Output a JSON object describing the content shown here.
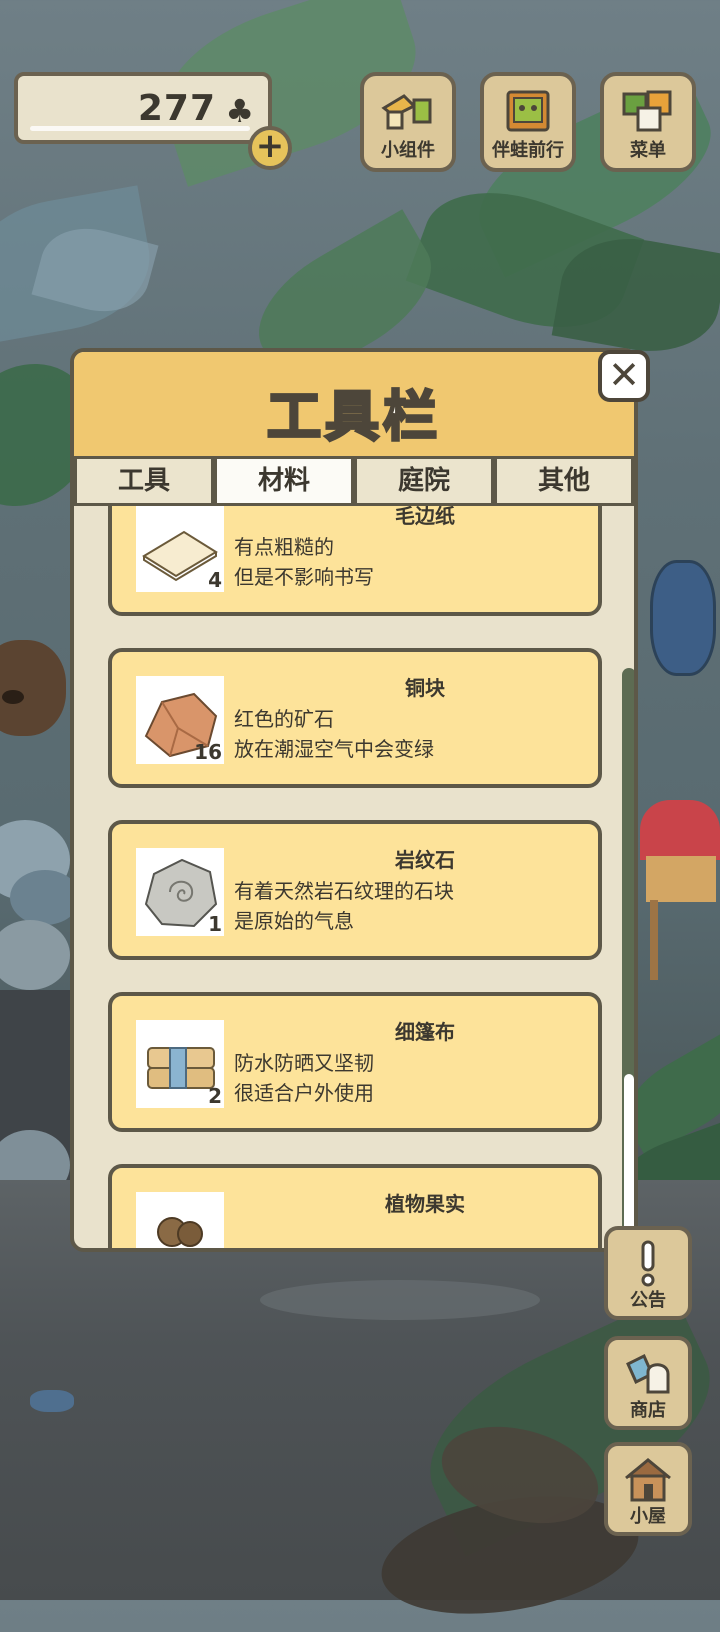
{
  "hud": {
    "clover_count": "277",
    "clover_icon": "clover-icon",
    "add_icon": "plus-icon",
    "top_buttons": [
      {
        "label": "小组件",
        "icon": "widget-icon"
      },
      {
        "label": "伴蛙前行",
        "icon": "frog-album-icon"
      },
      {
        "label": "菜单",
        "icon": "menu-icon"
      }
    ]
  },
  "panel": {
    "title": "工具栏",
    "close_icon": "close-icon",
    "tabs": [
      {
        "label": "工具",
        "active": false
      },
      {
        "label": "材料",
        "active": true
      },
      {
        "label": "庭院",
        "active": false
      },
      {
        "label": "其他",
        "active": false
      }
    ],
    "items": [
      {
        "name": "毛边纸",
        "qty": "4",
        "line1": "有点粗糙的",
        "line2": "但是不影响书写",
        "icon": "paper-icon"
      },
      {
        "name": "铜块",
        "qty": "16",
        "line1": "红色的矿石",
        "line2": "放在潮湿空气中会变绿",
        "icon": "copper-ore-icon"
      },
      {
        "name": "岩纹石",
        "qty": "1",
        "line1": "有着天然岩石纹理的石块",
        "line2": "是原始的气息",
        "icon": "rock-icon"
      },
      {
        "name": "细篷布",
        "qty": "2",
        "line1": "防水防晒又坚韧",
        "line2": "很适合户外使用",
        "icon": "canvas-cloth-icon"
      },
      {
        "name": "植物果实",
        "qty": "",
        "line1": "",
        "line2": "",
        "icon": "plant-fruit-icon"
      }
    ]
  },
  "side_buttons": [
    {
      "label": "公告",
      "icon": "exclamation-icon"
    },
    {
      "label": "商店",
      "icon": "shop-bag-icon"
    },
    {
      "label": "小屋",
      "icon": "house-icon"
    }
  ],
  "colors": {
    "panel_header": "#f0c870",
    "card_bg": "#fde39a",
    "panel_bg": "#e9e2cc",
    "outline": "#5d5848"
  }
}
